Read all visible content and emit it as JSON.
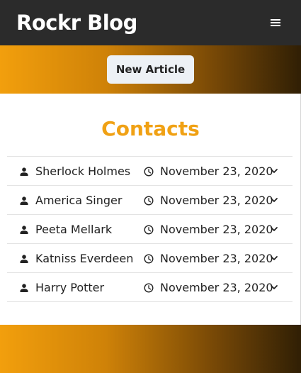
{
  "navbar": {
    "brand": "Rockr Blog",
    "menu_icon": "hamburger-menu-icon",
    "background": "#2b2b2b"
  },
  "hero": {
    "new_article_label": "New Article",
    "gradient": [
      "#f29f0d",
      "#301f05"
    ]
  },
  "main": {
    "title": "Contacts",
    "title_color": "#f0a114",
    "contacts": [
      {
        "name": "Sherlock Holmes",
        "date": "November 23, 2020"
      },
      {
        "name": "America Singer",
        "date": "November 23, 2020"
      },
      {
        "name": "Peeta Mellark",
        "date": "November 23, 2020"
      },
      {
        "name": "Katniss Everdeen",
        "date": "November 23, 2020"
      },
      {
        "name": "Harry Potter",
        "date": "November 23, 2020"
      }
    ],
    "row_icons": {
      "person": "user-icon",
      "time": "clock-icon",
      "expand": "chevron-down-icon"
    }
  }
}
